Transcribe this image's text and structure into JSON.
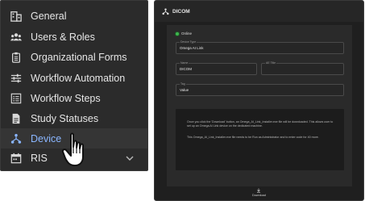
{
  "sidebar": {
    "items": [
      {
        "label": "General",
        "icon": "building-icon"
      },
      {
        "label": "Users & Roles",
        "icon": "users-icon"
      },
      {
        "label": "Organizational Forms",
        "icon": "clipboard-icon"
      },
      {
        "label": "Workflow Automation",
        "icon": "sliders-icon"
      },
      {
        "label": "Workflow Steps",
        "icon": "list-icon"
      },
      {
        "label": "Study Statuses",
        "icon": "document-icon"
      },
      {
        "label": "Device",
        "icon": "device-network-icon",
        "active": true
      },
      {
        "label": "RIS",
        "icon": "calendar-icon",
        "expandable": true
      }
    ],
    "active_color": "#8ab6ff"
  },
  "panel": {
    "title": "DICOM",
    "status": "Online",
    "status_color": "#3fb64f",
    "fields": {
      "device_type": {
        "label": "Device Type",
        "value": "Omega AI Link"
      },
      "name": {
        "label": "Name",
        "value": "DICOM"
      },
      "ae_title": {
        "label": "AE Title",
        "value": ""
      },
      "tag": {
        "label": "Tag",
        "value": "Value"
      }
    },
    "info_paragraph_1": "Once you click the 'Download' button, an Omega_AI_Link_Installer.exe file will be downloaded. This allows user to set up an Omega AI Link device on the dedicated machine.",
    "info_paragraph_2": "This Omega_AI_Link_Installer.exe file needs to be Run as Administrator and to enter code for 40 more.",
    "download_label": "Download"
  }
}
